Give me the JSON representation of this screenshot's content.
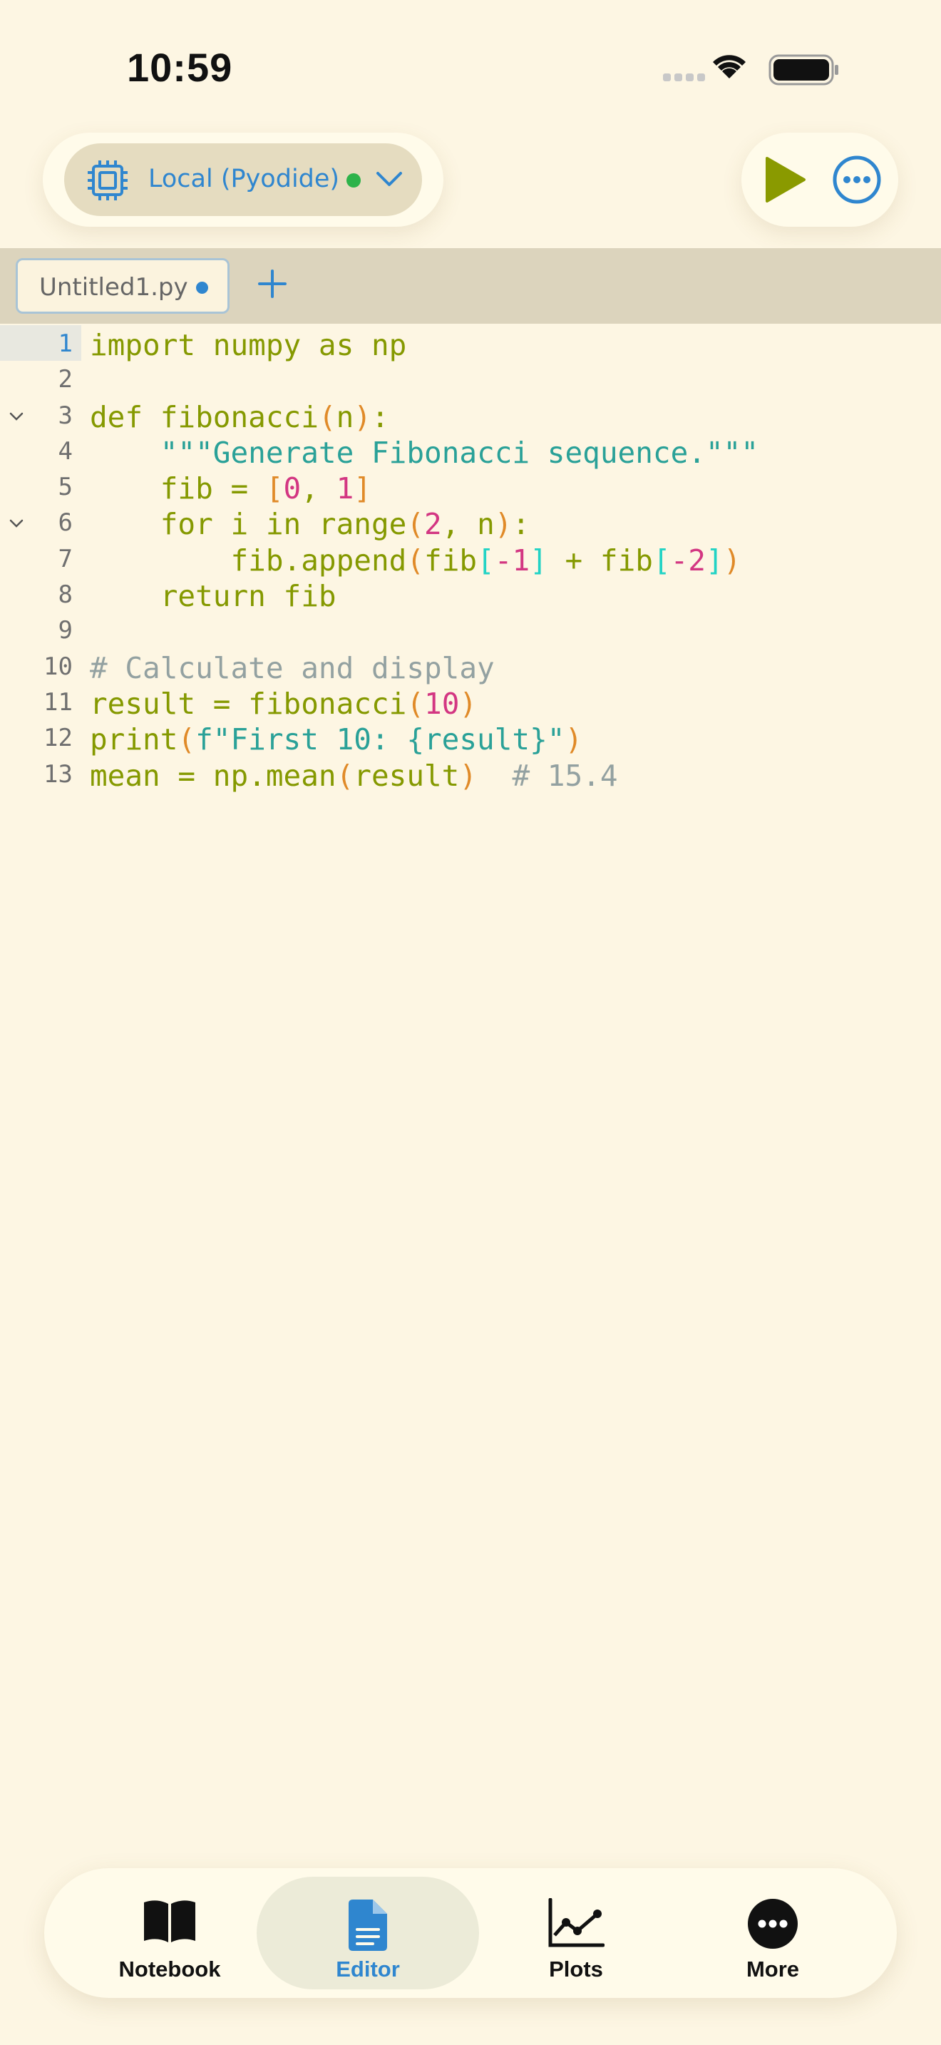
{
  "status_bar": {
    "time": "10:59"
  },
  "kernel": {
    "label": "Local (Pyodide)",
    "status_color": "#2db34a"
  },
  "colors": {
    "accent": "#2f86cf",
    "run": "#8a9a00",
    "background": "#fdf6e3"
  },
  "tabs": [
    {
      "label": "Untitled1.py",
      "modified": true
    }
  ],
  "editor": {
    "lines": [
      {
        "n": "1",
        "html": "import numpy as np",
        "current": true
      },
      {
        "n": "2",
        "html": ""
      },
      {
        "n": "3",
        "html": "def fibonacci<span class='tok-par'>(</span>n<span class='tok-par'>)</span>:",
        "fold": true
      },
      {
        "n": "4",
        "html": "    <span class='tok-str'>\"\"\"Generate Fibonacci sequence.\"\"\"</span>"
      },
      {
        "n": "5",
        "html": "    fib = <span class='tok-brk'>[</span><span class='tok-num'>0</span>, <span class='tok-num'>1</span><span class='tok-brk'>]</span>"
      },
      {
        "n": "6",
        "html": "    for i in range<span class='tok-par'>(</span><span class='tok-num'>2</span>, n<span class='tok-par'>)</span>:",
        "fold": true
      },
      {
        "n": "7",
        "html": "        fib.append<span class='tok-par'>(</span>fib<span class='tok-brk2'>[</span><span class='tok-num'>-1</span><span class='tok-brk2'>]</span> + fib<span class='tok-brk2'>[</span><span class='tok-num'>-2</span><span class='tok-brk2'>]</span><span class='tok-par'>)</span>"
      },
      {
        "n": "8",
        "html": "    return fib"
      },
      {
        "n": "9",
        "html": ""
      },
      {
        "n": "10",
        "html": "<span class='tok-com'># Calculate and display</span>"
      },
      {
        "n": "11",
        "html": "result = fibonacci<span class='tok-par'>(</span><span class='tok-num'>10</span><span class='tok-par'>)</span>"
      },
      {
        "n": "12",
        "html": "print<span class='tok-par'>(</span><span class='tok-str'>f\"First 10: {result}\"</span><span class='tok-par'>)</span>"
      },
      {
        "n": "13",
        "html": "mean = np.mean<span class='tok-par'>(</span>result<span class='tok-par'>)</span>  <span class='tok-com'># 15.4</span>"
      }
    ]
  },
  "bottom_nav": [
    {
      "label": "Notebook",
      "icon": "book-icon",
      "active": false
    },
    {
      "label": "Editor",
      "icon": "document-icon",
      "active": true
    },
    {
      "label": "Plots",
      "icon": "line-chart-icon",
      "active": false
    },
    {
      "label": "More",
      "icon": "ellipsis-circle-icon",
      "active": false
    }
  ]
}
